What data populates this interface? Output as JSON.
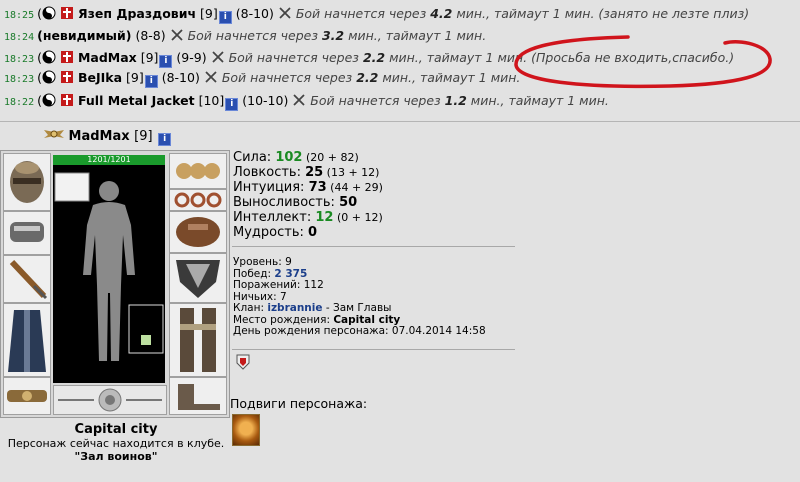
{
  "fights": [
    {
      "time": "18:25",
      "prefix": "(",
      "nick": "Язеп Драздович",
      "level": "[9]",
      "score": "(8-10)",
      "msg_pre": "Бой начнется через ",
      "minutes": "4.2",
      "msg_post": " мин., таймаут 1 мин.",
      "comment": " (занято не лезте плиз)"
    },
    {
      "time": "18:24",
      "prefix": "",
      "nick": "(невидимый)",
      "level": "",
      "score": "(8-8)",
      "msg_pre": "Бой начнется через ",
      "minutes": "3.2",
      "msg_post": " мин., таймаут 1 мин.",
      "comment": ""
    },
    {
      "time": "18:23",
      "prefix": "(",
      "nick": "MadMax",
      "level": "[9]",
      "score": "(9-9)",
      "msg_pre": "Бой начнется через ",
      "minutes": "2.2",
      "msg_post": " мин., таймаут 1 мин.",
      "comment": " (Просьба не входить,спасибо.)"
    },
    {
      "time": "18:23",
      "prefix": "(",
      "nick": "BeJIka",
      "level": "[9]",
      "score": "(8-10)",
      "msg_pre": "Бой начнется через ",
      "minutes": "2.2",
      "msg_post": " мин., таймаут 1 мин.",
      "comment": ""
    },
    {
      "time": "18:22",
      "prefix": "(",
      "nick": "Full Metal Jacket",
      "level": "[10]",
      "score": "(10-10)",
      "msg_pre": "Бой начнется через ",
      "minutes": "1.2",
      "msg_post": " мин., таймаут 1 мин.",
      "comment": ""
    }
  ],
  "info_icon_glyph": "i",
  "character": {
    "nick": "MadMax",
    "level": "[9]",
    "hp": "1201/1201",
    "stats": [
      {
        "label": "Сила: ",
        "value": "102",
        "mod": " (20 + 82)",
        "green": true
      },
      {
        "label": "Ловкость: ",
        "value": "25",
        "mod": " (13 + 12)",
        "green": false
      },
      {
        "label": "Интуиция: ",
        "value": "73",
        "mod": " (44 + 29)",
        "green": false
      },
      {
        "label": "Выносливость: ",
        "value": "50",
        "mod": "",
        "green": false
      },
      {
        "label": "Интеллект: ",
        "value": "12",
        "mod": " (0 + 12)",
        "green": true
      },
      {
        "label": "Мудрость: ",
        "value": "0",
        "mod": "",
        "green": false
      }
    ],
    "info": {
      "level_label": "Уровень: ",
      "level_value": "9",
      "wins_label": "Побед: ",
      "wins_value": "2 375",
      "losses_label": "Поражений: ",
      "losses_value": "112",
      "draws_label": "Ничьих: ",
      "draws_value": "7",
      "clan_label": "Клан: ",
      "clan_value": "izbrannie",
      "clan_role": " - Зам Главы",
      "birthplace_label": "Место рождения: ",
      "birthplace_value": "Capital city",
      "birthday_label": "День рождения персонажа: ",
      "birthday_value": "07.04.2014 14:58"
    },
    "location_city": "Capital city",
    "location_text": "Персонаж сейчас находится в клубе.",
    "location_room": "\"Зал воинов\"",
    "feats_label": "Подвиги персонажа:"
  },
  "colors": {
    "time": "#1a7a2a",
    "hp": "#1a9a2c",
    "annotation": "#d0141c",
    "link": "#1b3e8a"
  }
}
